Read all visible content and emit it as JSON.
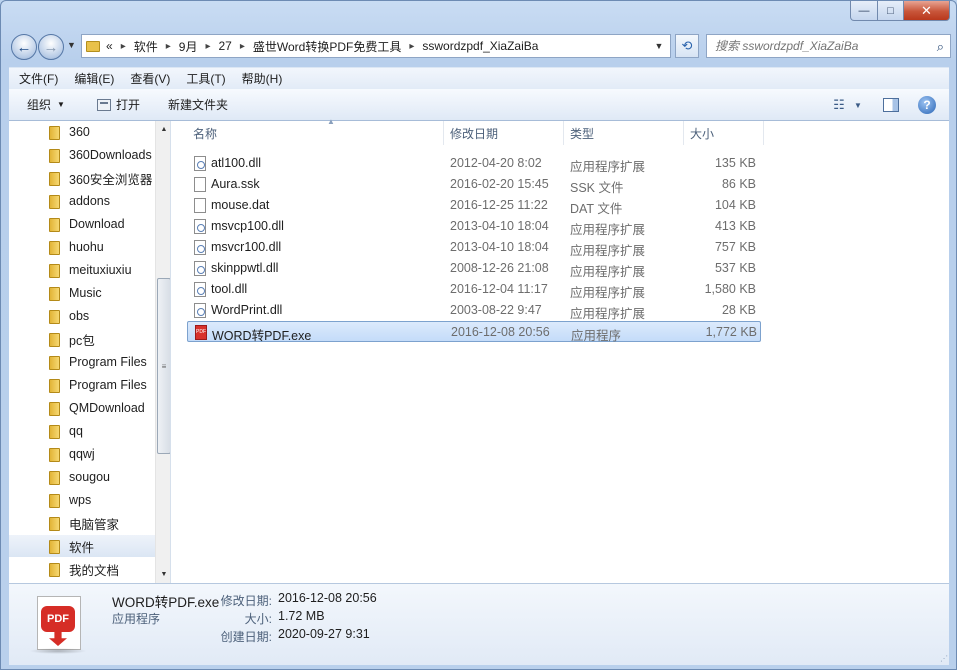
{
  "window": {
    "caption": {
      "minimize": "—",
      "maximize": "□",
      "close": "✕"
    }
  },
  "nav": {
    "back_icon": "←",
    "forward_icon": "→",
    "dropdown_icon": "▼",
    "refresh_icon": "⟲"
  },
  "address": {
    "overflow": "«",
    "crumbs": [
      "软件",
      "9月",
      "27",
      "盛世Word转换PDF免费工具",
      "sswordzpdf_XiaZaiBa"
    ],
    "separator": "▸",
    "chevron": "▼"
  },
  "search": {
    "placeholder": "搜索 sswordzpdf_XiaZaiBa",
    "icon": "⌕"
  },
  "menu": {
    "items": [
      "文件(F)",
      "编辑(E)",
      "查看(V)",
      "工具(T)",
      "帮助(H)"
    ]
  },
  "toolbar": {
    "organize": "组织",
    "open": "打开",
    "new_folder": "新建文件夹",
    "view_icon": "☷",
    "drop": "▼",
    "help": "?"
  },
  "tree": {
    "items": [
      {
        "label": "360",
        "selected": false
      },
      {
        "label": "360Downloads",
        "selected": false
      },
      {
        "label": "360安全浏览器",
        "selected": false
      },
      {
        "label": "addons",
        "selected": false
      },
      {
        "label": "Download",
        "selected": false
      },
      {
        "label": "huohu",
        "selected": false
      },
      {
        "label": "meituxiuxiu",
        "selected": false
      },
      {
        "label": "Music",
        "selected": false
      },
      {
        "label": "obs",
        "selected": false
      },
      {
        "label": "pc包",
        "selected": false
      },
      {
        "label": "Program Files",
        "selected": false
      },
      {
        "label": "Program Files",
        "selected": false
      },
      {
        "label": "QMDownload",
        "selected": false
      },
      {
        "label": "qq",
        "selected": false
      },
      {
        "label": "qqwj",
        "selected": false
      },
      {
        "label": "sougou",
        "selected": false
      },
      {
        "label": "wps",
        "selected": false
      },
      {
        "label": "电脑管家",
        "selected": false
      },
      {
        "label": "软件",
        "selected": true
      },
      {
        "label": "我的文档",
        "selected": false
      }
    ],
    "scroll_up": "▲",
    "scroll_down": "▼",
    "scroll_grip": "≡"
  },
  "columns": {
    "name": "名称",
    "date": "修改日期",
    "type": "类型",
    "size": "大小",
    "sort_arrow": "▲"
  },
  "files": [
    {
      "name": "atl100.dll",
      "date": "2012-04-20 8:02",
      "type": "应用程序扩展",
      "size": "135 KB",
      "icon": "dll",
      "selected": false
    },
    {
      "name": "Aura.ssk",
      "date": "2016-02-20 15:45",
      "type": "SSK 文件",
      "size": "86 KB",
      "icon": "file",
      "selected": false
    },
    {
      "name": "mouse.dat",
      "date": "2016-12-25 11:22",
      "type": "DAT 文件",
      "size": "104 KB",
      "icon": "file",
      "selected": false
    },
    {
      "name": "msvcp100.dll",
      "date": "2013-04-10 18:04",
      "type": "应用程序扩展",
      "size": "413 KB",
      "icon": "dll",
      "selected": false
    },
    {
      "name": "msvcr100.dll",
      "date": "2013-04-10 18:04",
      "type": "应用程序扩展",
      "size": "757 KB",
      "icon": "dll",
      "selected": false
    },
    {
      "name": "skinppwtl.dll",
      "date": "2008-12-26 21:08",
      "type": "应用程序扩展",
      "size": "537 KB",
      "icon": "dll",
      "selected": false
    },
    {
      "name": "tool.dll",
      "date": "2016-12-04 11:17",
      "type": "应用程序扩展",
      "size": "1,580 KB",
      "icon": "dll",
      "selected": false
    },
    {
      "name": "WordPrint.dll",
      "date": "2003-08-22 9:47",
      "type": "应用程序扩展",
      "size": "28 KB",
      "icon": "dll",
      "selected": false
    },
    {
      "name": "WORD转PDF.exe",
      "date": "2016-12-08 20:56",
      "type": "应用程序",
      "size": "1,772 KB",
      "icon": "exe",
      "selected": true
    }
  ],
  "details": {
    "name": "WORD转PDF.exe",
    "kind": "应用程序",
    "icon_badge": "PDF",
    "modified_label": "修改日期:",
    "modified_value": "2016-12-08 20:56",
    "size_label": "大小:",
    "size_value": "1.72 MB",
    "created_label": "创建日期:",
    "created_value": "2020-09-27 9:31",
    "grip": "⋰"
  }
}
